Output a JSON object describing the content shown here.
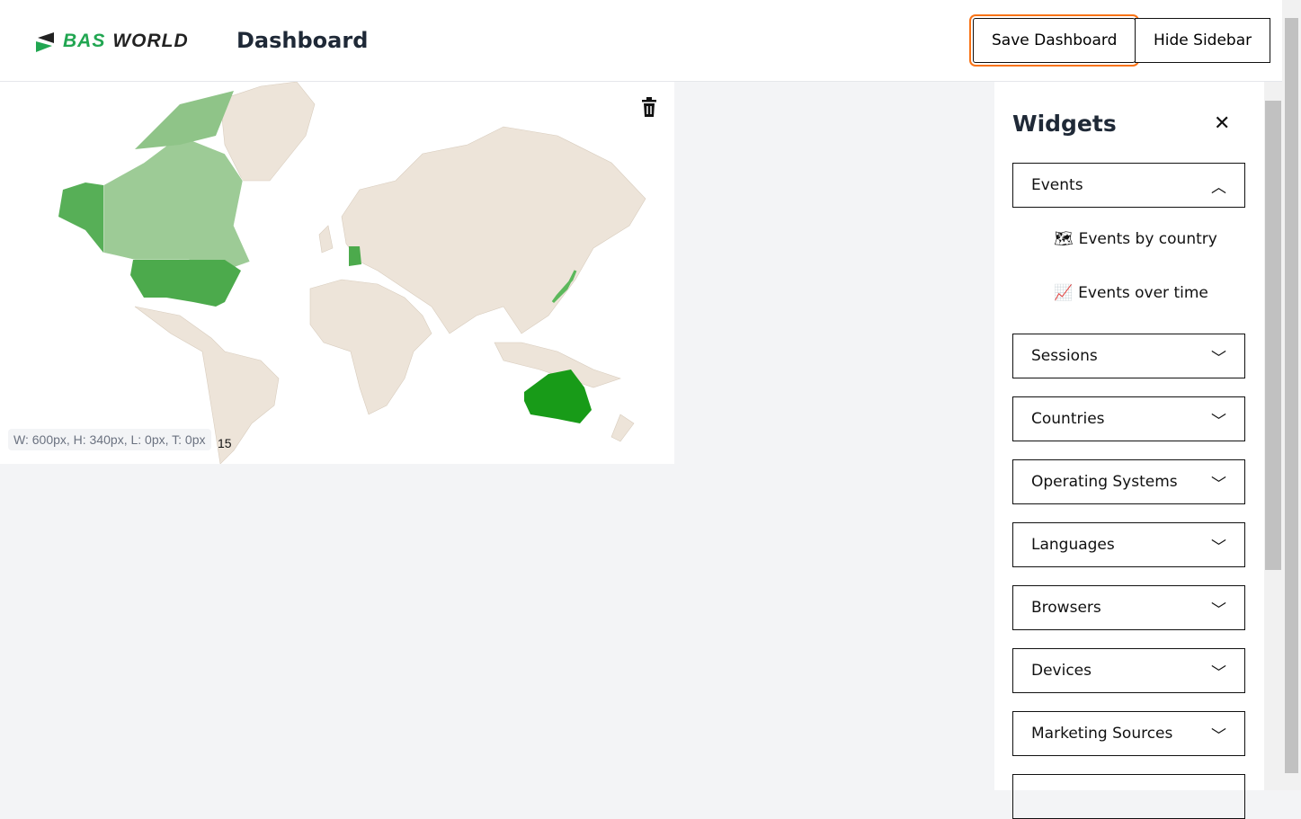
{
  "header": {
    "logo_text_1": "BAS",
    "logo_text_2": "WORLD",
    "title": "Dashboard",
    "save_label": "Save Dashboard",
    "hide_label": "Hide Sidebar"
  },
  "widget": {
    "size_label": "W: 600px, H: 340px, L: 0px, T: 0px",
    "counter": "15",
    "icon": "trash-icon",
    "highlighted_countries": {
      "United States": "#4caa4c",
      "Canada": "#9dcb96",
      "Alaska": "#57af57",
      "Australia": "#189b18",
      "Germany": "#4caa4c",
      "Japan": "#5cb85c"
    },
    "base_color": "#ede4d9"
  },
  "sidebar": {
    "title": "Widgets",
    "close": "✕",
    "groups": [
      {
        "label": "Events",
        "expanded": true,
        "items": [
          {
            "label": "Events by country",
            "icon": "map-icon"
          },
          {
            "label": "Events over time",
            "icon": "line-chart-icon"
          }
        ]
      },
      {
        "label": "Sessions"
      },
      {
        "label": "Countries"
      },
      {
        "label": "Operating Systems"
      },
      {
        "label": "Languages"
      },
      {
        "label": "Browsers"
      },
      {
        "label": "Devices"
      },
      {
        "label": "Marketing Sources"
      }
    ]
  }
}
